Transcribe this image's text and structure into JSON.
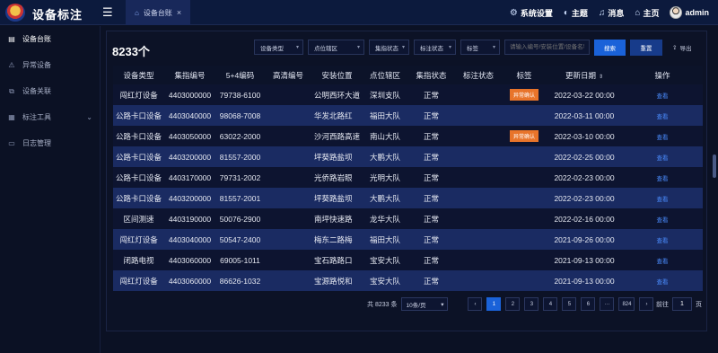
{
  "app": {
    "title": "设备标注"
  },
  "tabs": [
    {
      "label": "设备台账"
    }
  ],
  "topnav": {
    "system_settings": "系统设置",
    "theme": "主题",
    "messages": "消息",
    "home": "主页",
    "user": "admin"
  },
  "sidebar": {
    "items": [
      {
        "label": "设备台账",
        "icon": "ledger-icon",
        "active": true
      },
      {
        "label": "异常设备",
        "icon": "alert-icon"
      },
      {
        "label": "设备关联",
        "icon": "link-icon"
      },
      {
        "label": "标注工具",
        "icon": "tools-icon",
        "expandable": true
      },
      {
        "label": "日志管理",
        "icon": "log-icon"
      }
    ]
  },
  "toolbar": {
    "count": "8233个",
    "filters": [
      "设备类型",
      "点位辖区",
      "集指状态",
      "标注状态",
      "标签"
    ],
    "search_placeholder": "请输入编号/安装位置/设备名称",
    "search_button": "搜索",
    "reset_button": "重置",
    "export_button": "导出"
  },
  "table": {
    "columns": [
      "设备类型",
      "集指编号",
      "5+4编码",
      "高清编号",
      "安装位置",
      "点位辖区",
      "集指状态",
      "标注状态",
      "标签",
      "更新日期",
      "操作"
    ],
    "rows": [
      {
        "type": "闯红灯设备",
        "code": "4403000000",
        "code54": "79738-6100",
        "hd": "",
        "location": "公明西环大道",
        "area": "深圳支队",
        "status": "正常",
        "mark": "",
        "tag": "异常确认",
        "date": "2022-03-22 00:00",
        "action": "查看"
      },
      {
        "type": "公路卡口设备",
        "code": "4403040000",
        "code54": "98068-7008",
        "hd": "",
        "location": "华发北路红",
        "area": "福田大队",
        "status": "正常",
        "mark": "",
        "tag": "",
        "date": "2022-03-11 00:00",
        "action": "查看"
      },
      {
        "type": "公路卡口设备",
        "code": "4403050000",
        "code54": "63022-2000",
        "hd": "",
        "location": "沙河西路高速",
        "area": "南山大队",
        "status": "正常",
        "mark": "",
        "tag": "异常确认",
        "date": "2022-03-10 00:00",
        "action": "查看"
      },
      {
        "type": "公路卡口设备",
        "code": "4403200000",
        "code54": "81557-2000",
        "hd": "",
        "location": "坪葵路盐坝",
        "area": "大鹏大队",
        "status": "正常",
        "mark": "",
        "tag": "",
        "date": "2022-02-25 00:00",
        "action": "查看"
      },
      {
        "type": "公路卡口设备",
        "code": "4403170000",
        "code54": "79731-2002",
        "hd": "",
        "location": "光侨路岩眼",
        "area": "光明大队",
        "status": "正常",
        "mark": "",
        "tag": "",
        "date": "2022-02-23 00:00",
        "action": "查看"
      },
      {
        "type": "公路卡口设备",
        "code": "4403200000",
        "code54": "81557-2001",
        "hd": "",
        "location": "坪葵路盐坝",
        "area": "大鹏大队",
        "status": "正常",
        "mark": "",
        "tag": "",
        "date": "2022-02-23 00:00",
        "action": "查看"
      },
      {
        "type": "区间测速",
        "code": "4403190000",
        "code54": "50076-2900",
        "hd": "",
        "location": "南坪快速路",
        "area": "龙华大队",
        "status": "正常",
        "mark": "",
        "tag": "",
        "date": "2022-02-16 00:00",
        "action": "查看"
      },
      {
        "type": "闯红灯设备",
        "code": "4403040000",
        "code54": "50547-2400",
        "hd": "",
        "location": "梅东二路梅",
        "area": "福田大队",
        "status": "正常",
        "mark": "",
        "tag": "",
        "date": "2021-09-26 00:00",
        "action": "查看"
      },
      {
        "type": "闭路电视",
        "code": "4403060000",
        "code54": "69005-1011",
        "hd": "",
        "location": "宝石路路口",
        "area": "宝安大队",
        "status": "正常",
        "mark": "",
        "tag": "",
        "date": "2021-09-13 00:00",
        "action": "查看"
      },
      {
        "type": "闯红灯设备",
        "code": "4403060000",
        "code54": "86626-1032",
        "hd": "",
        "location": "宝源路悦和",
        "area": "宝安大队",
        "status": "正常",
        "mark": "",
        "tag": "",
        "date": "2021-09-13 00:00",
        "action": "查看"
      }
    ]
  },
  "pagination": {
    "total": "共 8233 条",
    "page_size": "10条/页",
    "pages": [
      "1",
      "2",
      "3",
      "4",
      "5",
      "6",
      "···",
      "824"
    ],
    "current": "1",
    "goto_prefix": "前往",
    "goto_value": "1",
    "goto_suffix": "页"
  },
  "colors": {
    "accent": "#1a62d9",
    "badge": "#e8742a",
    "link": "#4b8dff",
    "row_alt": "#1a2b62"
  }
}
